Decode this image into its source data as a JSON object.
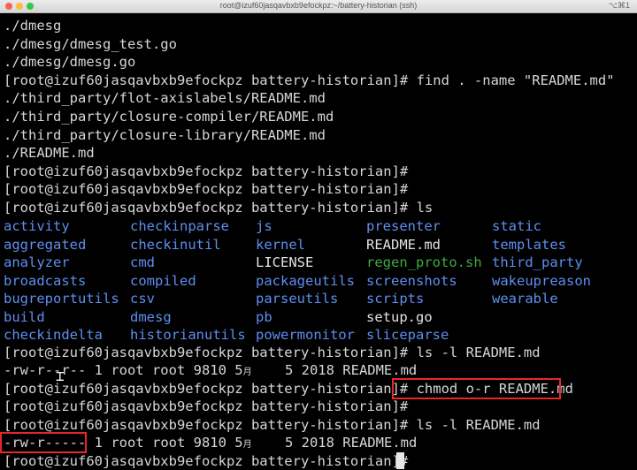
{
  "window": {
    "title": "root@izuf60jasqavbxb9efockpz:~/battery-historian (ssh)",
    "shortcut": "⌥⌘1"
  },
  "lines_top": [
    "./dmesg",
    "./dmesg/dmesg_test.go",
    "./dmesg/dmesg.go",
    "[root@izuf60jasqavbxb9efockpz battery-historian]# find . -name \"README.md\"",
    "./third_party/flot-axislabels/README.md",
    "./third_party/closure-compiler/README.md",
    "./third_party/closure-library/README.md",
    "./README.md",
    "[root@izuf60jasqavbxb9efockpz battery-historian]#",
    "[root@izuf60jasqavbxb9efockpz battery-historian]#",
    "[root@izuf60jasqavbxb9efockpz battery-historian]# ls"
  ],
  "ls_rows": [
    [
      {
        "name": "activity",
        "type": "dir"
      },
      {
        "name": "checkinparse",
        "type": "dir"
      },
      {
        "name": "js",
        "type": "dir"
      },
      {
        "name": "presenter",
        "type": "dir"
      },
      {
        "name": "static",
        "type": "dir"
      }
    ],
    [
      {
        "name": "aggregated",
        "type": "dir"
      },
      {
        "name": "checkinutil",
        "type": "dir"
      },
      {
        "name": "kernel",
        "type": "dir"
      },
      {
        "name": "README.md",
        "type": "file"
      },
      {
        "name": "templates",
        "type": "dir"
      }
    ],
    [
      {
        "name": "analyzer",
        "type": "dir"
      },
      {
        "name": "cmd",
        "type": "dir"
      },
      {
        "name": "LICENSE",
        "type": "file"
      },
      {
        "name": "regen_proto.sh",
        "type": "exec"
      },
      {
        "name": "third_party",
        "type": "dir"
      }
    ],
    [
      {
        "name": "broadcasts",
        "type": "dir"
      },
      {
        "name": "compiled",
        "type": "dir"
      },
      {
        "name": "packageutils",
        "type": "dir"
      },
      {
        "name": "screenshots",
        "type": "dir"
      },
      {
        "name": "wakeupreason",
        "type": "dir"
      }
    ],
    [
      {
        "name": "bugreportutils",
        "type": "dir"
      },
      {
        "name": "csv",
        "type": "dir"
      },
      {
        "name": "parseutils",
        "type": "dir"
      },
      {
        "name": "scripts",
        "type": "dir"
      },
      {
        "name": "wearable",
        "type": "dir"
      }
    ],
    [
      {
        "name": "build",
        "type": "dir"
      },
      {
        "name": "dmesg",
        "type": "dir"
      },
      {
        "name": "pb",
        "type": "dir"
      },
      {
        "name": "setup.go",
        "type": "file"
      },
      {
        "name": "",
        "type": "dir"
      }
    ],
    [
      {
        "name": "checkindelta",
        "type": "dir"
      },
      {
        "name": "historianutils",
        "type": "dir"
      },
      {
        "name": "powermonitor",
        "type": "dir"
      },
      {
        "name": "sliceparse",
        "type": "dir"
      },
      {
        "name": "",
        "type": "dir"
      }
    ]
  ],
  "lines_bottom": {
    "ls1_cmd": "[root@izuf60jasqavbxb9efockpz battery-historian]# ls -l README.md",
    "ls1_result_pre": "-rw-r--r-- 1 root root 9810 5",
    "month_char": "月",
    "ls1_result_post": "    5 2018 README.md",
    "prompt": "[root@izuf60jasqavbxb9efockpz battery-historian]# ",
    "chmod_cmd": "chmod o-r README.md",
    "blank_prompt": "[root@izuf60jasqavbxb9efockpz battery-historian]#",
    "ls2_cmd": "[root@izuf60jasqavbxb9efockpz battery-historian]# ls -l README.md",
    "ls2_perms": "-rw-r-----",
    "ls2_rest_pre": " 1 root root 9810 5",
    "ls2_rest_post": "    5 2018 README.md",
    "final_prompt": "[root@izuf60jasqavbxb9efockpz battery-historian]# "
  },
  "colors": {
    "directory": "#5f8ef0",
    "executable": "#3faa3f",
    "highlight_box": "#e8262a"
  }
}
